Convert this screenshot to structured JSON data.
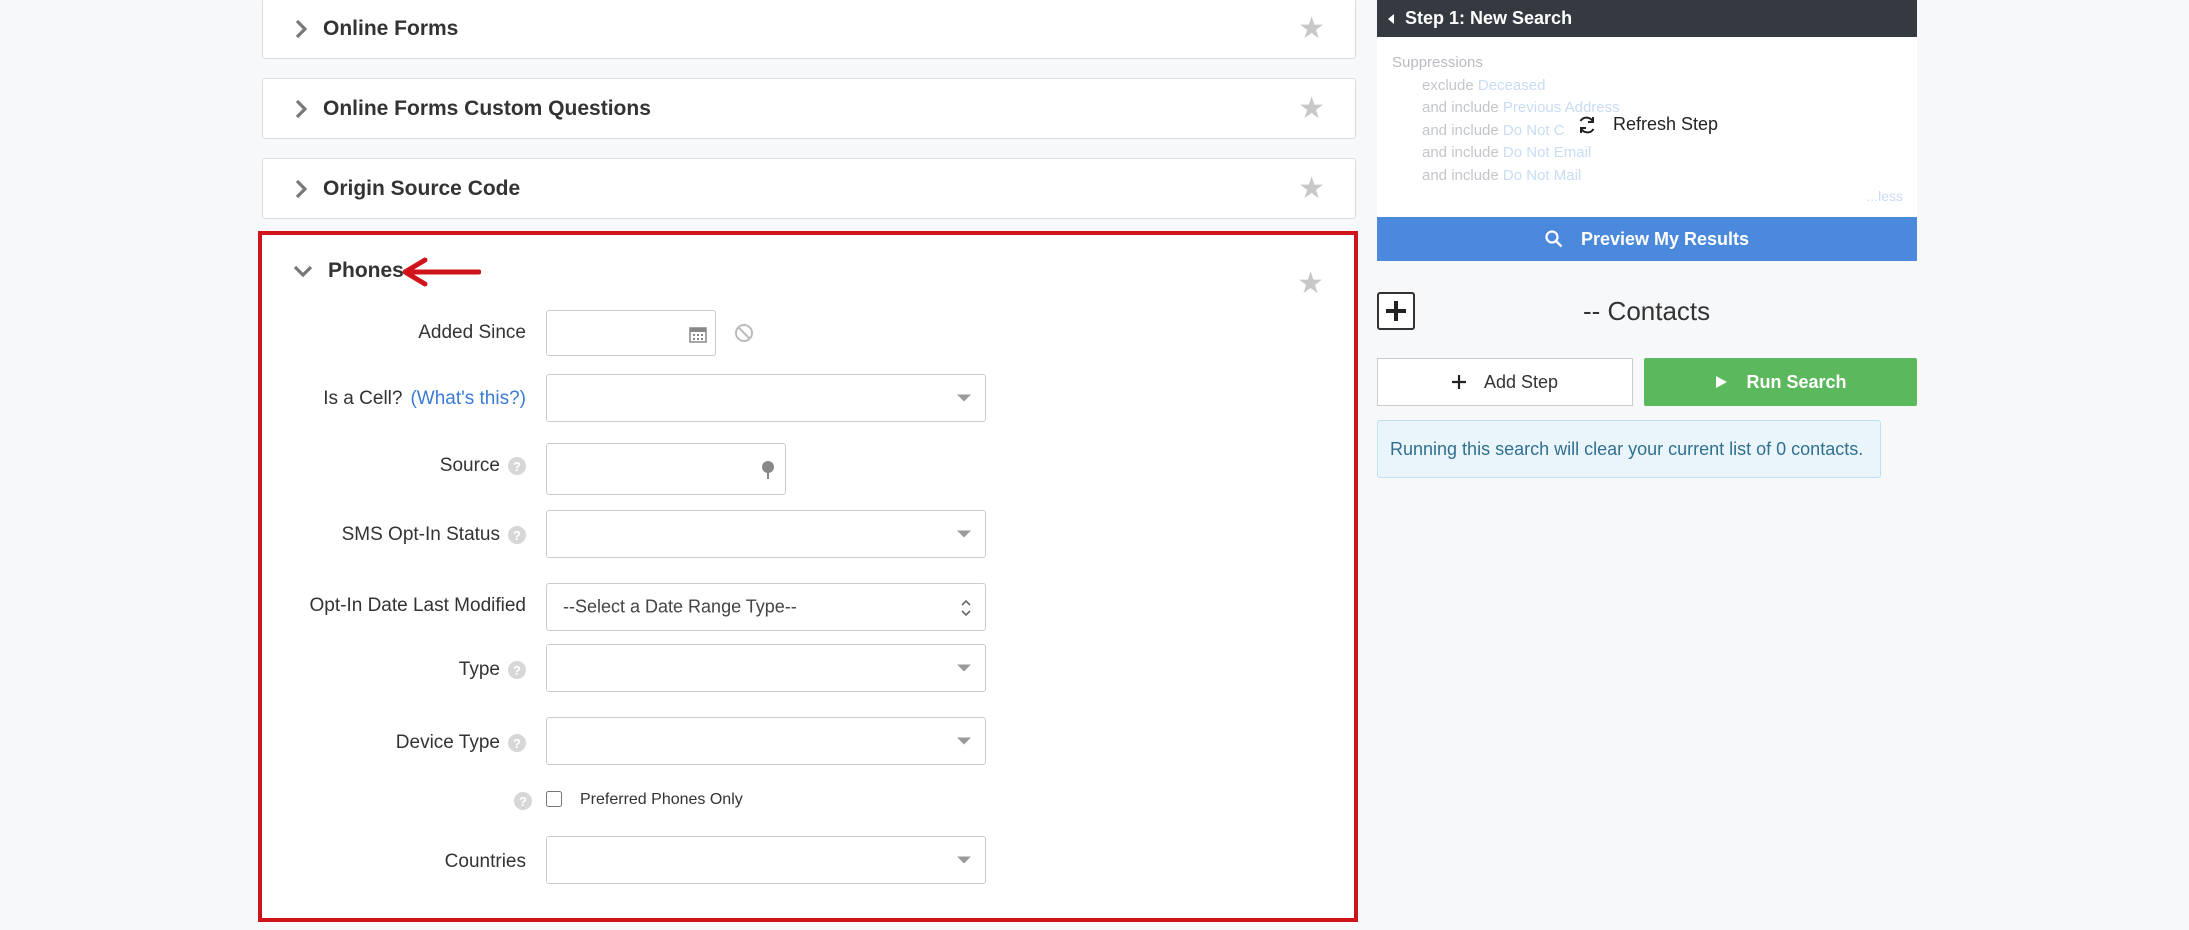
{
  "panels": [
    {
      "title": "Online Forms"
    },
    {
      "title": "Online Forms Custom Questions"
    },
    {
      "title": "Origin Source Code"
    }
  ],
  "phones": {
    "title": "Phones",
    "fields": {
      "added_since": "Added Since",
      "is_cell": "Is a Cell?",
      "is_cell_link": "(What's this?)",
      "source": "Source",
      "sms_optin": "SMS Opt-In Status",
      "optin_date": "Opt-In Date Last Modified",
      "optin_date_value": "--Select a Date Range Type--",
      "type": "Type",
      "device_type": "Device Type",
      "preferred_only": "Preferred Phones Only",
      "countries": "Countries"
    }
  },
  "step": {
    "header": "Step 1: New Search",
    "suppressions_label": "Suppressions",
    "lines": [
      {
        "prefix": "exclude",
        "value": "Deceased"
      },
      {
        "prefix": "and include",
        "value": "Previous Address"
      },
      {
        "prefix": "and include",
        "value": "Do Not C"
      },
      {
        "prefix": "and include",
        "value": "Do Not Email"
      },
      {
        "prefix": "and include",
        "value": "Do Not Mail"
      }
    ],
    "less": "...less",
    "refresh": "Refresh Step"
  },
  "actions": {
    "preview": "Preview My Results",
    "contacts_title": "-- Contacts",
    "add_step": "Add Step",
    "run_search": "Run Search",
    "notice": "Running this search will clear your current list of 0 contacts."
  },
  "colors": {
    "highlight_border": "#d0141b",
    "preview_button": "#4a89dc",
    "run_button": "#5cb85c",
    "step_header": "#343a40"
  }
}
